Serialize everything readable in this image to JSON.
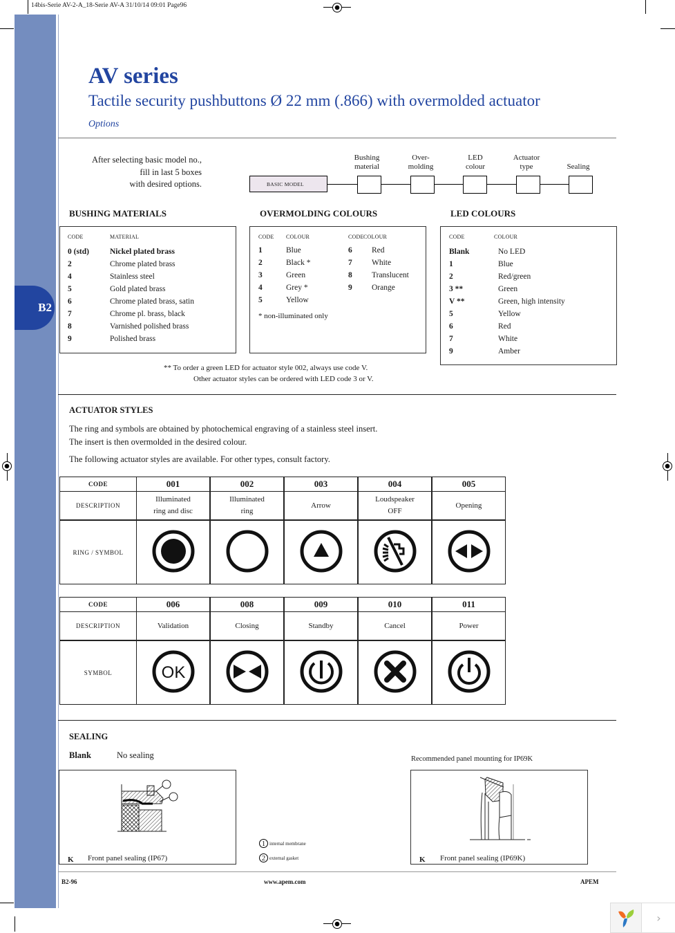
{
  "print_header": "14bis-Serie AV-2-A_18-Serie AV-A  31/10/14  09:01  Page96",
  "side_tab": "B2",
  "title": "AV series",
  "subtitle": "Tactile security pushbuttons Ø 22 mm (.866) with overmolded actuator",
  "section_label": "Options",
  "configurator": {
    "intro_lines": [
      "After selecting basic model no.,",
      "fill in last 5 boxes",
      "with desired options."
    ],
    "basic_model_label": "BASIC MODEL",
    "boxes": [
      {
        "label_lines": [
          "Bushing",
          "material"
        ]
      },
      {
        "label_lines": [
          "Over-",
          "molding"
        ]
      },
      {
        "label_lines": [
          "LED",
          "colour"
        ]
      },
      {
        "label_lines": [
          "Actuator",
          "type"
        ]
      },
      {
        "label_lines": [
          "Sealing"
        ]
      }
    ]
  },
  "bushing_materials": {
    "title": "BUSHING MATERIALS",
    "headers": [
      "CODE",
      "MATERIAL"
    ],
    "rows": [
      {
        "code": "0 (std)",
        "value": "Nickel plated brass",
        "bold": true
      },
      {
        "code": "2",
        "value": "Chrome plated brass"
      },
      {
        "code": "4",
        "value": "Stainless steel"
      },
      {
        "code": "5",
        "value": "Gold plated brass"
      },
      {
        "code": "6",
        "value": "Chrome plated brass, satin"
      },
      {
        "code": "7",
        "value": "Chrome pl. brass, black"
      },
      {
        "code": "8",
        "value": "Varnished polished brass"
      },
      {
        "code": "9",
        "value": "Polished brass"
      }
    ]
  },
  "overmolding_colours": {
    "title": "OVERMOLDING COLOURS",
    "headers": [
      "CODE",
      "COLOUR",
      "CODE",
      "COLOUR"
    ],
    "left_rows": [
      {
        "code": "1",
        "value": "Blue"
      },
      {
        "code": "2",
        "value": "Black *"
      },
      {
        "code": "3",
        "value": "Green"
      },
      {
        "code": "4",
        "value": "Grey *"
      },
      {
        "code": "5",
        "value": "Yellow"
      }
    ],
    "right_rows": [
      {
        "code": "6",
        "value": "Red"
      },
      {
        "code": "7",
        "value": "White"
      },
      {
        "code": "8",
        "value": "Translucent"
      },
      {
        "code": "9",
        "value": "Orange"
      }
    ],
    "footnote": "* non-illuminated only"
  },
  "led_colours": {
    "title": "LED COLOURS",
    "headers": [
      "CODE",
      "COLOUR"
    ],
    "rows": [
      {
        "code": "Blank",
        "value": "No LED"
      },
      {
        "code": "1",
        "value": "Blue"
      },
      {
        "code": "2",
        "value": "Red/green"
      },
      {
        "code": "3 **",
        "value": "Green"
      },
      {
        "code": "V **",
        "value": "Green, high intensity"
      },
      {
        "code": "5",
        "value": "Yellow"
      },
      {
        "code": "6",
        "value": "Red"
      },
      {
        "code": "7",
        "value": "White"
      },
      {
        "code": "9",
        "value": "Amber"
      }
    ],
    "note_lines": [
      "** To order a green LED for actuator style 002, always use code V.",
      "Other actuator styles can be ordered with LED code 3 or V."
    ]
  },
  "actuator_styles": {
    "title": "ACTUATOR STYLES",
    "paragraphs": [
      "The ring and symbols are obtained by photochemical engraving of a stainless steel insert.",
      "The insert is then overmolded in the desired colour.",
      "The following actuator styles are available. For other types, consult factory."
    ],
    "table1": {
      "row_labels": [
        "CODE",
        "DESCRIPTION",
        "RING / SYMBOL"
      ],
      "items": [
        {
          "code": "001",
          "desc_lines": [
            "Illuminated",
            "ring and disc"
          ],
          "icon": "ring-disc-icon"
        },
        {
          "code": "002",
          "desc_lines": [
            "Illuminated",
            "ring"
          ],
          "icon": "ring-icon"
        },
        {
          "code": "003",
          "desc_lines": [
            "Arrow"
          ],
          "icon": "arrow-up-icon"
        },
        {
          "code": "004",
          "desc_lines": [
            "Loudspeaker",
            "OFF"
          ],
          "icon": "loudspeaker-off-icon"
        },
        {
          "code": "005",
          "desc_lines": [
            "Opening"
          ],
          "icon": "opening-arrows-icon"
        }
      ]
    },
    "table2": {
      "row_labels": [
        "CODE",
        "DESCRIPTION",
        "SYMBOL"
      ],
      "items": [
        {
          "code": "006",
          "desc_lines": [
            "Validation"
          ],
          "icon": "ok-icon",
          "symbol_text": "OK"
        },
        {
          "code": "008",
          "desc_lines": [
            "Closing"
          ],
          "icon": "closing-arrows-icon"
        },
        {
          "code": "009",
          "desc_lines": [
            "Standby"
          ],
          "icon": "standby-icon"
        },
        {
          "code": "010",
          "desc_lines": [
            "Cancel"
          ],
          "icon": "cancel-x-icon"
        },
        {
          "code": "011",
          "desc_lines": [
            "Power"
          ],
          "icon": "power-icon"
        }
      ]
    }
  },
  "sealing": {
    "title": "SEALING",
    "blank_code": "Blank",
    "blank_value": "No sealing",
    "recommended_label": "Recommended panel mounting for IP69K",
    "option_k_ip67": {
      "code": "K",
      "caption": "Front panel sealing (IP67)"
    },
    "option_k_ip69k": {
      "code": "K",
      "caption": "Front panel sealing (IP69K)"
    },
    "legend": [
      {
        "num": "1",
        "label": "internal membrane"
      },
      {
        "num": "2",
        "label": "external gasket"
      }
    ]
  },
  "footer": {
    "page": "B2-96",
    "url": "www.apem.com",
    "brand": "APEM"
  },
  "widget": {
    "arrow": "›"
  },
  "colors": {
    "brand_blue": "#2245a0",
    "sidebar": "#748dbf",
    "basic_model_fill": "#ede6ee"
  }
}
